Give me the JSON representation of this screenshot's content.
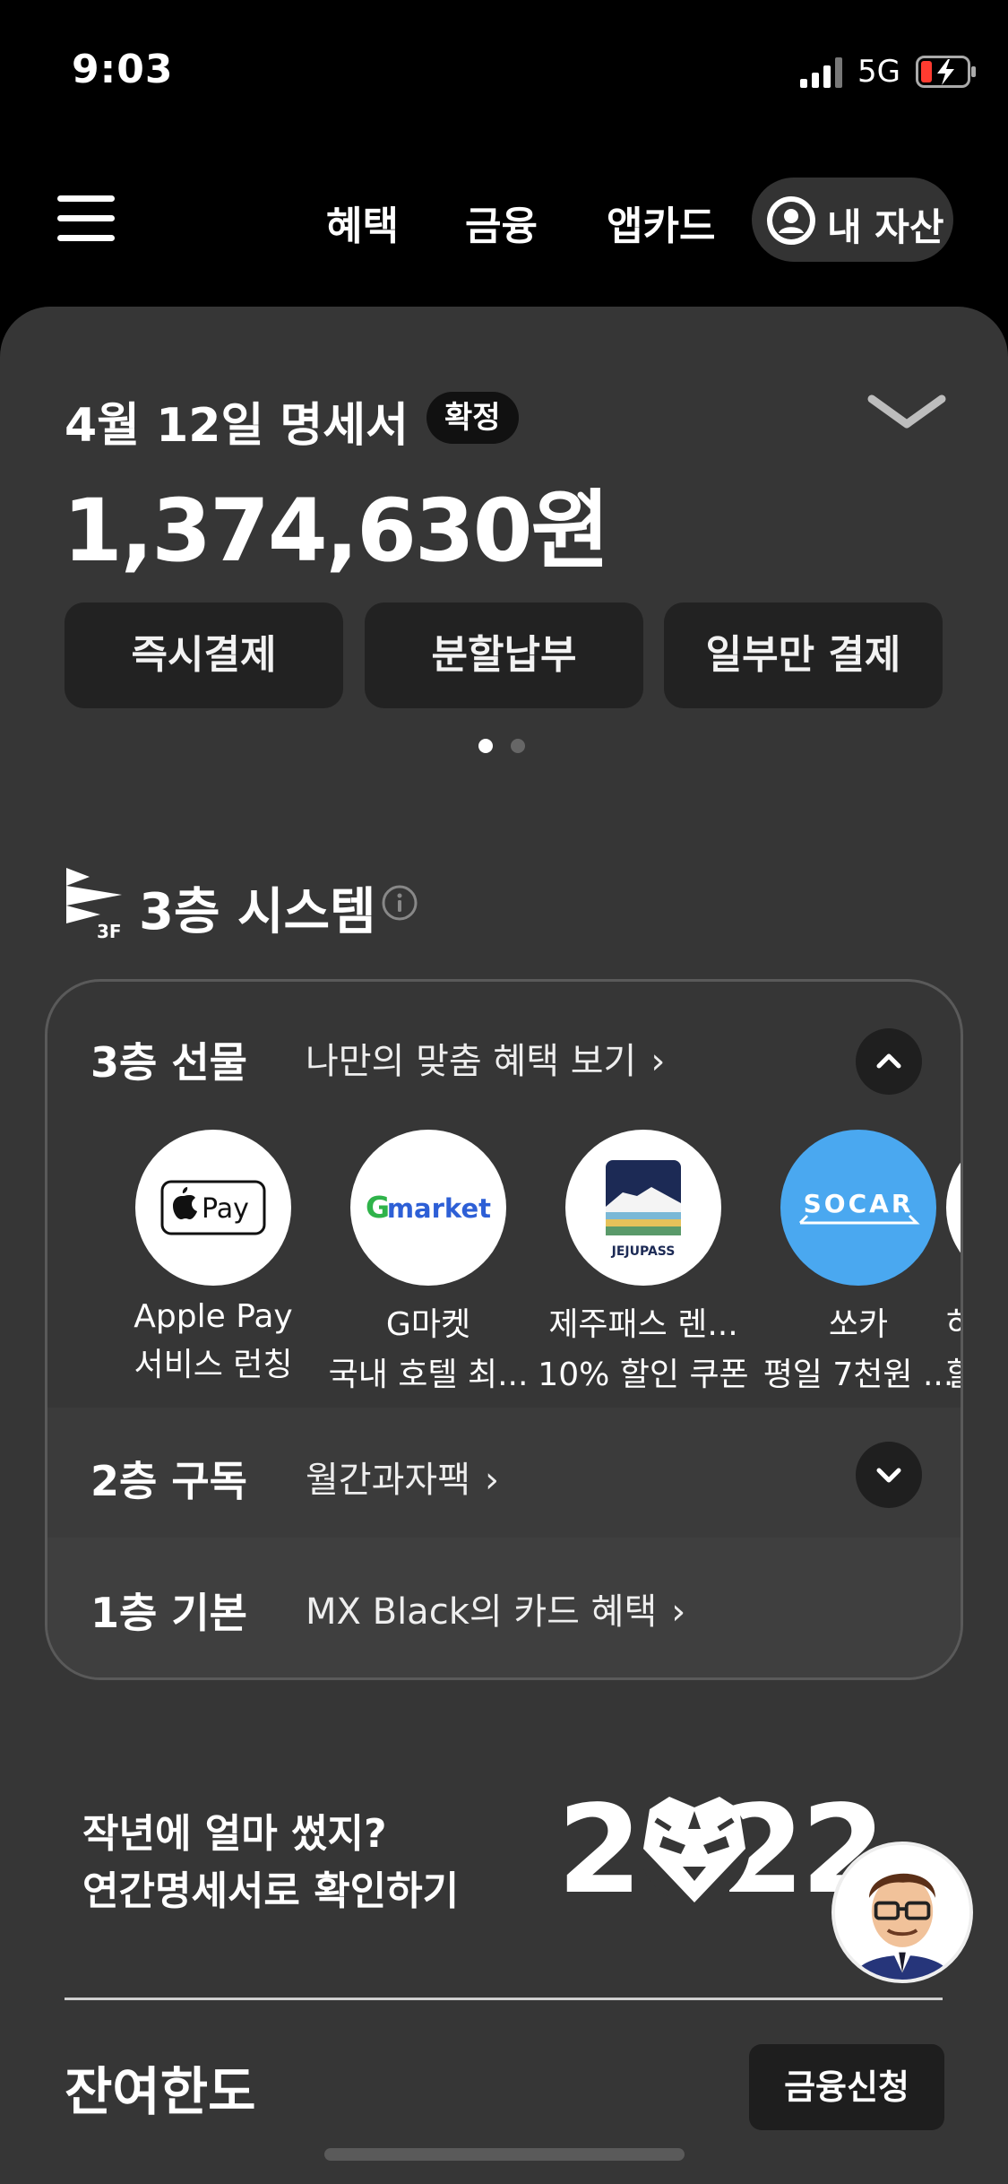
{
  "status_bar": {
    "time": "9:03",
    "network": "5G",
    "icons": [
      "signal-icon",
      "battery-charging-icon"
    ]
  },
  "nav": {
    "menu_icon": "hamburger-menu-icon",
    "links": [
      "혜택",
      "금융",
      "앱카드"
    ],
    "asset_button": "내 자산",
    "asset_icon": "user-circle-icon"
  },
  "statement": {
    "title": "4월 12일 명세서",
    "badge": "확정",
    "amount": "1,374,630원",
    "actions": [
      "즉시결제",
      "분할납부",
      "일부만 결제"
    ],
    "page_indicator": {
      "current": 1,
      "total": 2
    }
  },
  "system": {
    "logo_text": "3F",
    "title": "3층 시스템",
    "layer3": {
      "name": "3층 선물",
      "link": "나만의 맞춤 혜택 보기",
      "gifts": [
        {
          "name": "Apple Pay",
          "desc": "서비스 런칭",
          "logo_text": "Pay"
        },
        {
          "name": "G마켓",
          "desc": "국내 호텔 최...",
          "logo_text": "Gmarket"
        },
        {
          "name": "제주패스 렌...",
          "desc": "10% 할인 쿠폰",
          "logo_text": "JEJUPASS"
        },
        {
          "name": "쏘카",
          "desc": "평일 7천원 ...",
          "logo_text": "SOCAR"
        },
        {
          "name": "하",
          "desc": "할"
        }
      ]
    },
    "layer2": {
      "name": "2층 구독",
      "link": "월간과자팩"
    },
    "layer1": {
      "name": "1층 기본",
      "link": "MX Black의 카드 혜택"
    }
  },
  "annual": {
    "line1": "작년에 얼마 썼지?",
    "line2": "연간명세서로 확인하기",
    "art_text": "2022"
  },
  "limit": {
    "title": "잔여한도",
    "apply_button": "금융신청"
  },
  "colors": {
    "background": "#000000",
    "card": "#363636",
    "button": "#222222",
    "socar_blue": "#4aa8f0",
    "gmarket_green": "#2fb34a",
    "gmarket_blue": "#2d5fd6",
    "battery_red": "#ff3b30"
  }
}
